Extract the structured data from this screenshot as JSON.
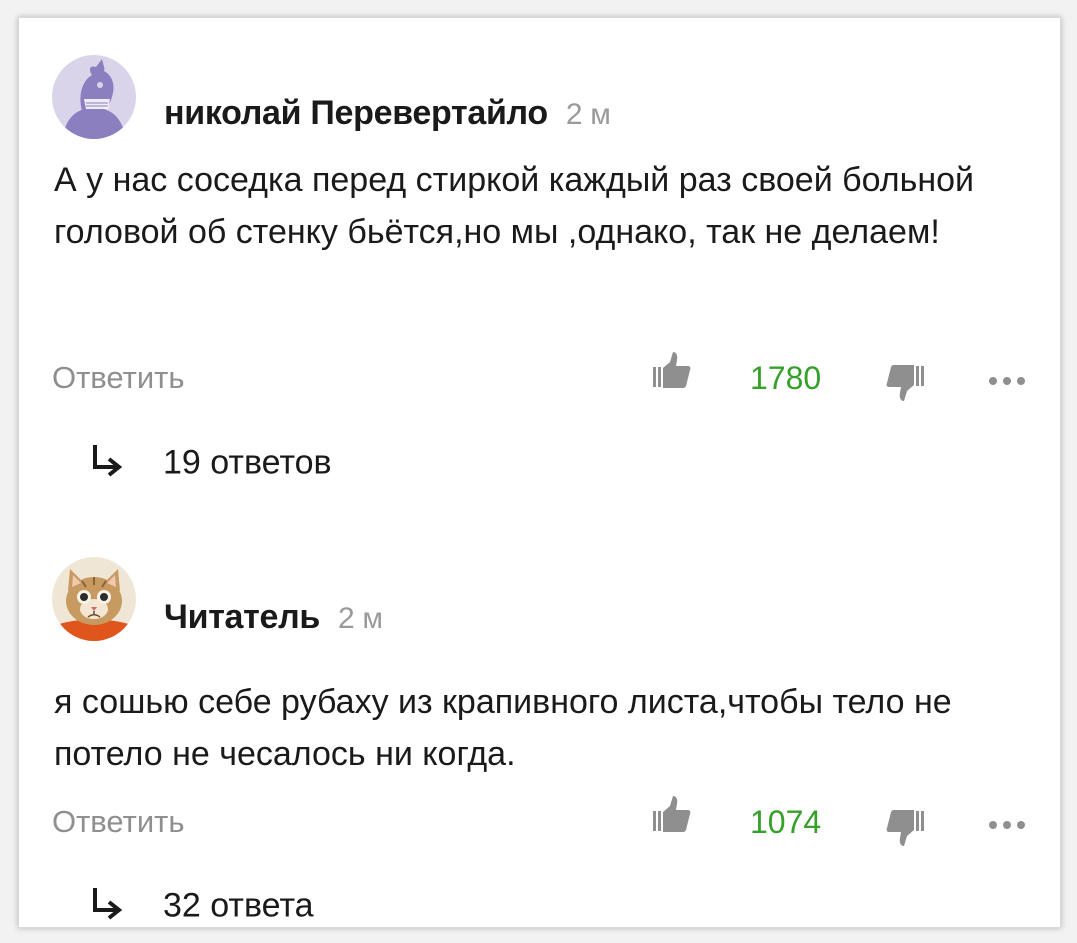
{
  "comments": [
    {
      "author": "николай Перевертайло",
      "time": "2 м",
      "avatar": "bird-avatar-icon",
      "text": "А у нас соседка перед стиркой каждый раз своей больной головой об стенку бьётся,но мы ,однако, так не делаем!",
      "reply_label": "Ответить",
      "likes": "1780",
      "replies_label": "19 ответов"
    },
    {
      "author": "Читатель",
      "time": "2 м",
      "avatar": "cat-avatar-icon",
      "text": "я сошью себе рубаху из крапивного листа,чтобы тело не потело не чесалось ни когда.",
      "reply_label": "Ответить",
      "likes": "1074",
      "replies_label": "32 ответа"
    }
  ],
  "colors": {
    "likes": "#35a12a",
    "muted": "#9a9a9a",
    "text": "#1a1a1a",
    "avatar_bird_bg": "#d9d4ea",
    "avatar_bird_fg": "#8b7fbf"
  },
  "icons": [
    "thumbs-up-icon",
    "thumbs-down-icon",
    "more-dots-icon",
    "reply-arrow-icon"
  ]
}
